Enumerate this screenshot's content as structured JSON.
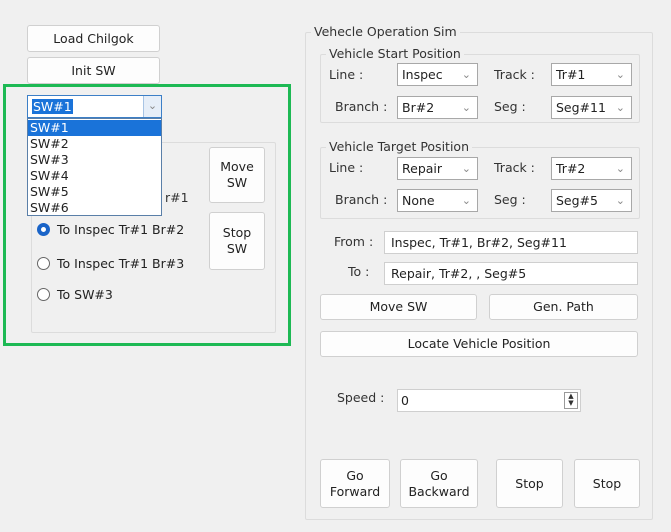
{
  "left": {
    "load_button": "Load Chilgok",
    "init_button": "Init SW",
    "sw_combo": {
      "value": "SW#1",
      "options": [
        "SW#1",
        "SW#2",
        "SW#3",
        "SW#4",
        "SW#5",
        "SW#6"
      ]
    },
    "radios": [
      {
        "label": "r#1",
        "checked": false
      },
      {
        "label": "To Inspec Tr#1 Br#2",
        "checked": true
      },
      {
        "label": "To Inspec Tr#1 Br#3",
        "checked": false
      },
      {
        "label": "To SW#3",
        "checked": false
      }
    ],
    "move_sw": "Move SW",
    "stop_sw": "Stop SW",
    "highlight_color": "#1db954"
  },
  "sim": {
    "title": "Vehecle Operation Sim",
    "start": {
      "title": "Vehicle Start Position",
      "line_label": "Line :",
      "line": "Inspec",
      "track_label": "Track :",
      "track": "Tr#1",
      "branch_label": "Branch :",
      "branch": "Br#2",
      "seg_label": "Seg :",
      "seg": "Seg#11"
    },
    "target": {
      "title": "Vehicle Target Position",
      "line_label": "Line :",
      "line": "Repair",
      "track_label": "Track :",
      "track": "Tr#2",
      "branch_label": "Branch :",
      "branch": "None",
      "seg_label": "Seg :",
      "seg": "Seg#5"
    },
    "from_label": "From :",
    "from": "Inspec, Tr#1, Br#2, Seg#11",
    "to_label": "To :",
    "to": "Repair, Tr#2, , Seg#5",
    "move_sw": "Move SW",
    "gen_path": "Gen. Path",
    "locate": "Locate Vehicle Position",
    "speed_label": "Speed :",
    "speed": "0",
    "go_forward": "Go Forward",
    "go_backward": "Go Backward",
    "stop1": "Stop",
    "stop2": "Stop"
  }
}
